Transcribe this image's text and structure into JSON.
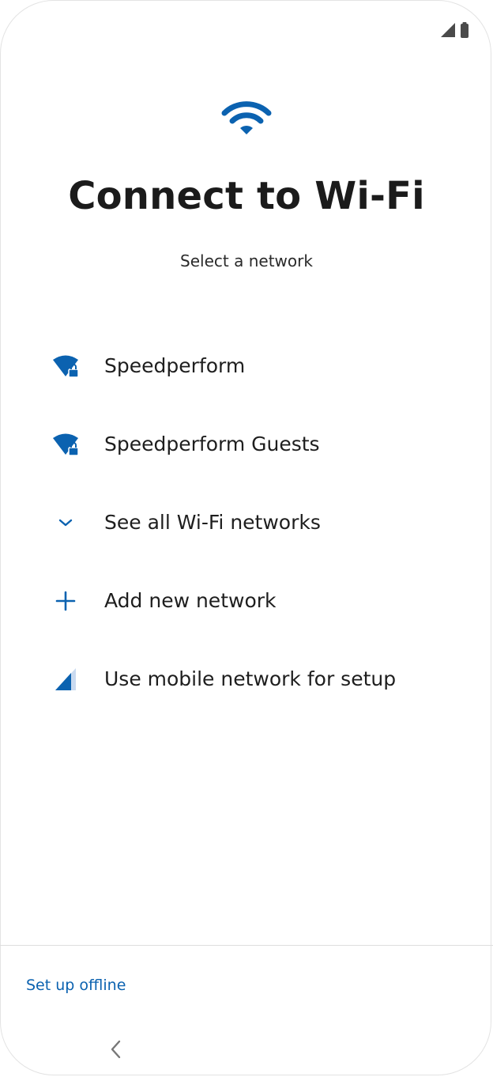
{
  "colors": {
    "accent": "#0b62b0",
    "text": "#1e1e1e",
    "divider": "#dedede"
  },
  "status_bar": {
    "icons": [
      "cell-signal-icon",
      "battery-icon"
    ]
  },
  "hero": {
    "icon": "wifi-icon",
    "title": "Connect to Wi-Fi",
    "subtitle": "Select a network"
  },
  "network_list": {
    "items": [
      {
        "icon": "wifi-lock-icon",
        "label": "Speedperform"
      },
      {
        "icon": "wifi-lock-icon",
        "label": "Speedperform Guests"
      },
      {
        "icon": "chevron-down-icon",
        "label": "See all Wi-Fi networks"
      },
      {
        "icon": "plus-icon",
        "label": "Add new network"
      },
      {
        "icon": "mobile-signal-icon",
        "label": "Use mobile network for setup"
      }
    ]
  },
  "footer": {
    "offline_label": "Set up offline"
  },
  "nav": {
    "back_icon": "back-chevron-icon"
  }
}
